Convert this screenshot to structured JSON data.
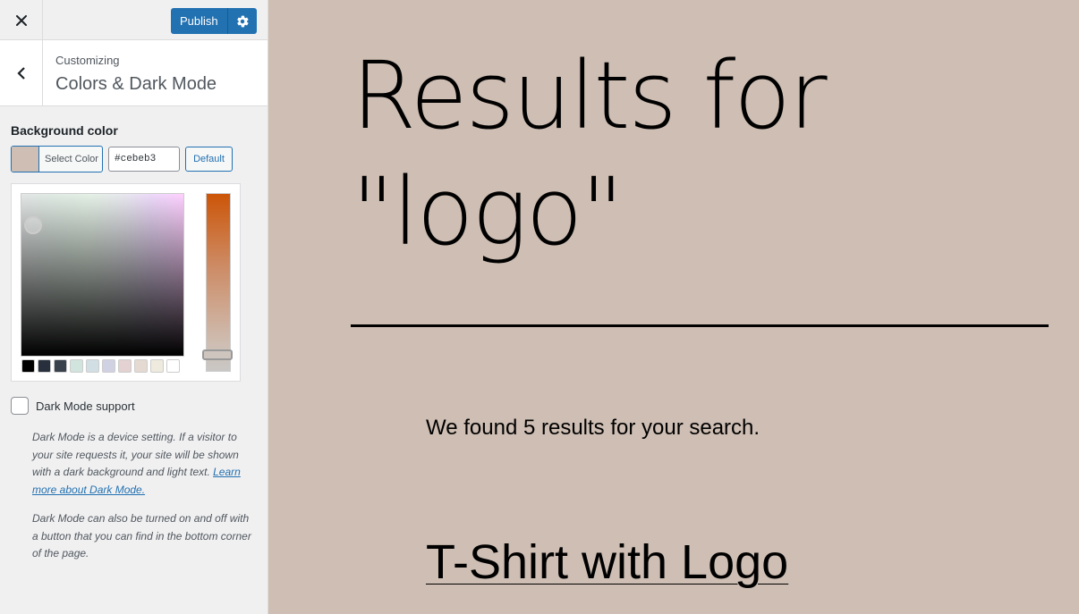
{
  "topbar": {
    "close_label": "×",
    "publish_label": "Publish"
  },
  "section": {
    "subtitle": "Customizing",
    "title": "Colors & Dark Mode"
  },
  "background_control": {
    "label": "Background color",
    "select_color_label": "Select Color",
    "hex_value": "#cebeb3",
    "default_label": "Default",
    "current_color": "#cebeb3",
    "palette": [
      "#000000",
      "#28303d",
      "#39414d",
      "#d1e4dd",
      "#d1dfe4",
      "#d1d1e4",
      "#e4d1d1",
      "#e4dad1",
      "#eeeadd",
      "#ffffff"
    ]
  },
  "dark_mode": {
    "label": "Dark Mode support",
    "checked": false,
    "desc1_text": "Dark Mode is a device setting. If a visitor to your site requests it, your site will be shown with a dark background and light text. ",
    "desc1_link": "Learn more about Dark Mode.",
    "desc2": "Dark Mode can also be turned on and off with a button that you can find in the bottom corner of the page."
  },
  "preview": {
    "heading": "Results for \"logo\"",
    "found_text": "We found 5 results for your search.",
    "post_title": "T-Shirt with Logo"
  },
  "colors": {
    "accent": "#2271b1",
    "preview_bg": "#cebeb3"
  }
}
